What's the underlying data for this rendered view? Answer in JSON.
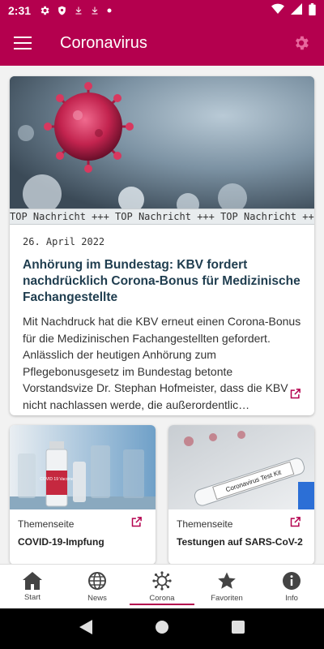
{
  "status": {
    "time": "2:31"
  },
  "appbar": {
    "title": "Coronavirus"
  },
  "top_card": {
    "ticker": "TOP Nachricht +++ TOP Nachricht +++ TOP Nachricht +++",
    "date": "26. April 2022",
    "headline": "Anhörung im Bundestag: KBV fordert nachdrücklich Corona-Bonus für Medizinische Fachangestellte",
    "body": "Mit Nachdruck hat die KBV erneut einen Corona-Bonus für die Medizinischen Fachangestellten gefordert. Anlässlich der heutigen Anhörung zum Pflegebonusgesetz im Bundestag betonte Vorstandsvize Dr. Stephan Hofmeister, dass die KBV nicht nachlassen werde, die außerordentlic…"
  },
  "cards": [
    {
      "label": "Themenseite",
      "title": "COVID-19-Impfung",
      "vial_text": "COVID 19 Vaccine"
    },
    {
      "label": "Themenseite",
      "title": "Testungen auf SARS-CoV-2",
      "kit_text": "Coronavirus Test Kit"
    }
  ],
  "nav": [
    {
      "label": "Start",
      "icon": "home-icon"
    },
    {
      "label": "News",
      "icon": "globe-icon"
    },
    {
      "label": "Corona",
      "icon": "virus-icon"
    },
    {
      "label": "Favoriten",
      "icon": "star-icon"
    },
    {
      "label": "Info",
      "icon": "info-icon"
    }
  ],
  "colors": {
    "primary": "#b4004e",
    "headline": "#1f3d4f"
  }
}
